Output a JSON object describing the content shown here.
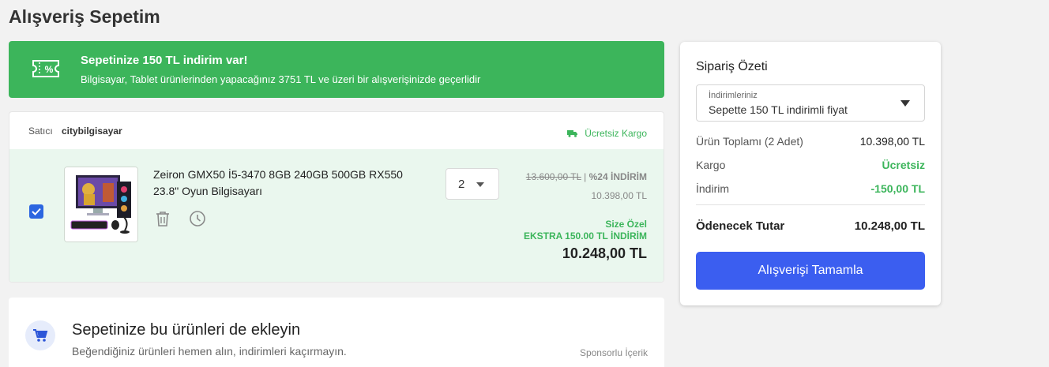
{
  "page": {
    "title": "Alışveriş Sepetim"
  },
  "promo": {
    "title": "Sepetinize 150 TL indirim var!",
    "description": "Bilgisayar, Tablet ürünlerinden yapacağınız 3751 TL ve üzeri bir alışverişinizde geçerlidir",
    "icon": "coupon-icon",
    "icon_glyph": "%",
    "background_color": "#3cb55b"
  },
  "seller": {
    "label": "Satıcı",
    "name": "citybilgisayar",
    "cargo_label": "Ücretsiz Kargo",
    "cargo_icon": "truck-icon"
  },
  "cart_item": {
    "checked": true,
    "product_name": "Zeiron GMX50 İ5-3470 8GB 240GB 500GB RX550 23.8\" Oyun Bilgisayarı",
    "quantity": "2",
    "old_price": "13.600,00 TL",
    "separator": "|",
    "discount_percent": "%24 İNDİRİM",
    "discounted_price": "10.398,00 TL",
    "special_label": "Size Özel",
    "extra_discount": "EKSTRA 150.00 TL İNDİRİM",
    "final_price": "10.248,00 TL",
    "icons": [
      "trash-icon",
      "clock-icon"
    ]
  },
  "recommend": {
    "title": "Sepetinize bu ürünleri de ekleyin",
    "subtitle": "Beğendiğiniz ürünleri hemen alın, indirimleri kaçırmayın.",
    "sponsored": "Sponsorlu İçerik",
    "icon": "cart-icon"
  },
  "summary": {
    "title": "Sipariş Özeti",
    "discount_select_label": "İndirimleriniz",
    "discount_select_value": "Sepette 150 TL indirimli fiyat",
    "rows": [
      {
        "label": "Ürün Toplamı (2 Adet)",
        "value": "10.398,00 TL"
      },
      {
        "label": "Kargo",
        "value": "Ücretsiz"
      },
      {
        "label": "İndirim",
        "value": "-150,00 TL"
      }
    ],
    "total_label": "Ödenecek Tutar",
    "total_value": "10.248,00 TL",
    "checkout_label": "Alışverişi Tamamla",
    "accent_color": "#3b5ef0"
  }
}
